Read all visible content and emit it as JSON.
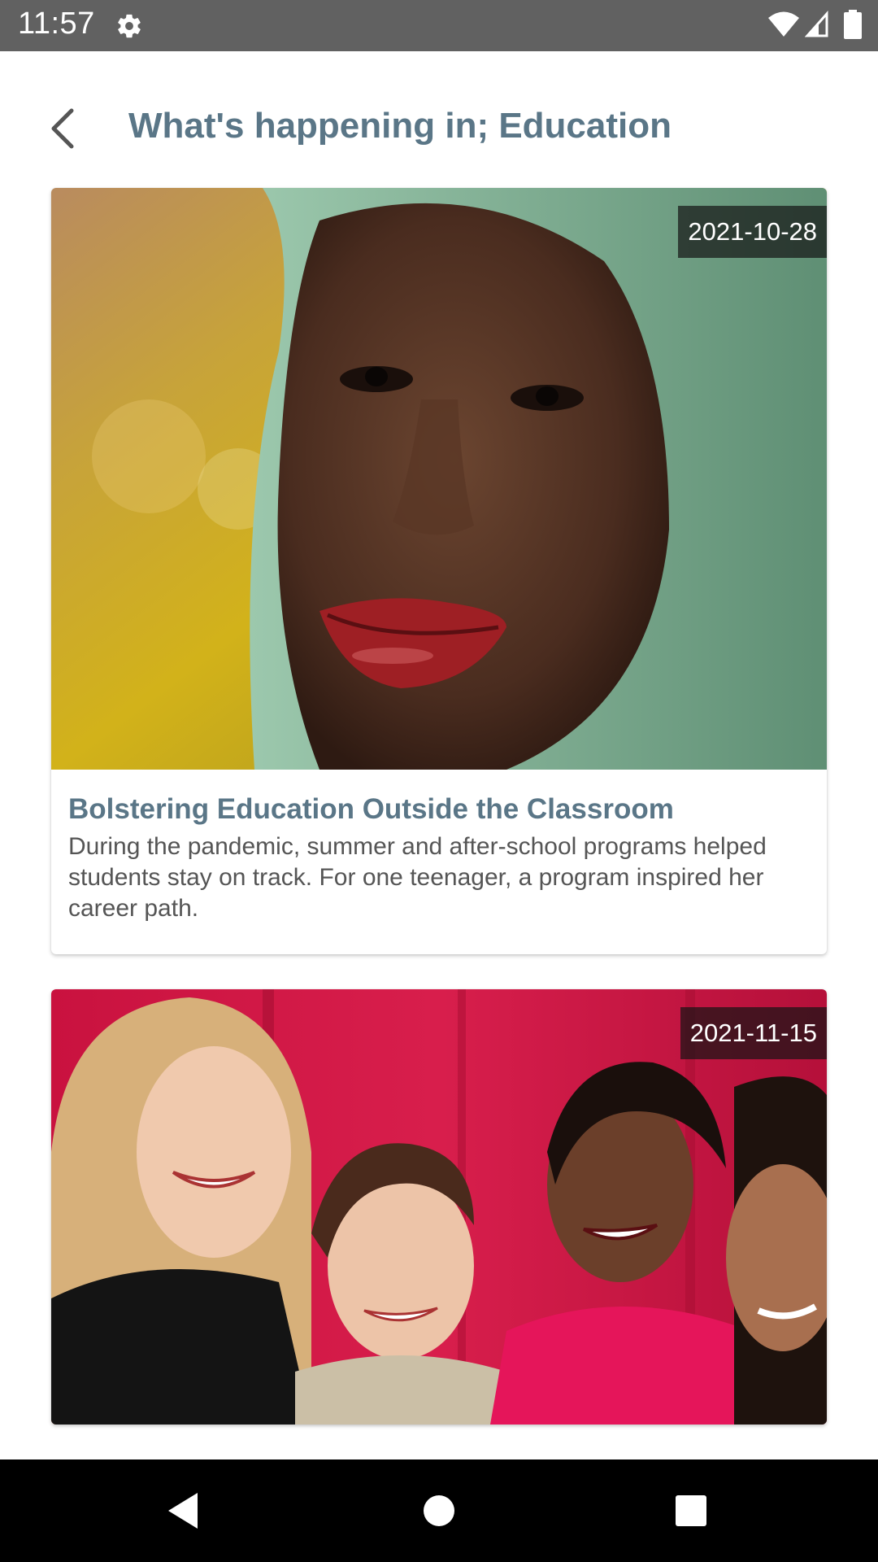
{
  "status_bar": {
    "time": "11:57",
    "icons": [
      "settings-gear-icon",
      "wifi-icon",
      "cell-signal-icon",
      "battery-icon"
    ]
  },
  "header": {
    "title": "What's happening in; Education",
    "back_icon": "chevron-left-icon"
  },
  "articles": [
    {
      "date": "2021-10-28",
      "title": "Bolstering Education Outside the Classroom",
      "description": "During the pandemic, summer and after-school programs helped students stay on track. For one teenager, a program inspired her career path."
    },
    {
      "date": "2021-11-15"
    }
  ],
  "nav_bar": {
    "icons": [
      "nav-back-triangle-icon",
      "nav-home-circle-icon",
      "nav-recents-square-icon"
    ]
  },
  "colors": {
    "accent": "#5a7687",
    "status_bar": "#616161",
    "nav_bar": "#000000"
  }
}
